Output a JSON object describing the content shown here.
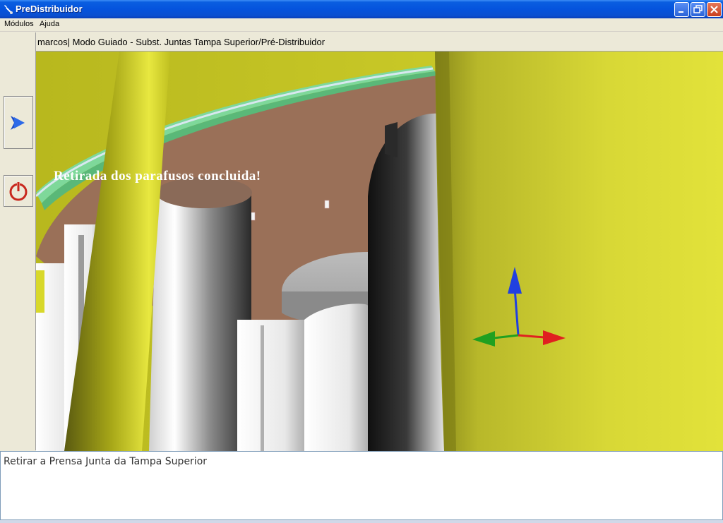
{
  "window": {
    "title": "PreDistribuidor",
    "icon": "app-wrench-icon",
    "controls": [
      "minimize-icon",
      "maximize-icon",
      "close-icon"
    ]
  },
  "menu": {
    "items": [
      {
        "label": "Módulos",
        "accel": "M"
      },
      {
        "label": "Ajuda",
        "accel": "A"
      }
    ]
  },
  "sidebar": {
    "buttons": [
      {
        "icon": "next-arrow-icon",
        "color": "#1e4fc8"
      },
      {
        "icon": "power-icon",
        "color": "#c8281e"
      }
    ]
  },
  "header": {
    "text": "marcos| Modo Guiado - Subst. Juntas Tampa Superior/Pré-Distribuidor"
  },
  "viewport": {
    "overlay_message": "Retirada dos parafusos concluida!",
    "axis_colors": {
      "x": "#e02020",
      "y": "#20a020",
      "z": "#2040e0"
    }
  },
  "instruction": {
    "text": "Retirar a Prensa Junta da Tampa Superior"
  }
}
